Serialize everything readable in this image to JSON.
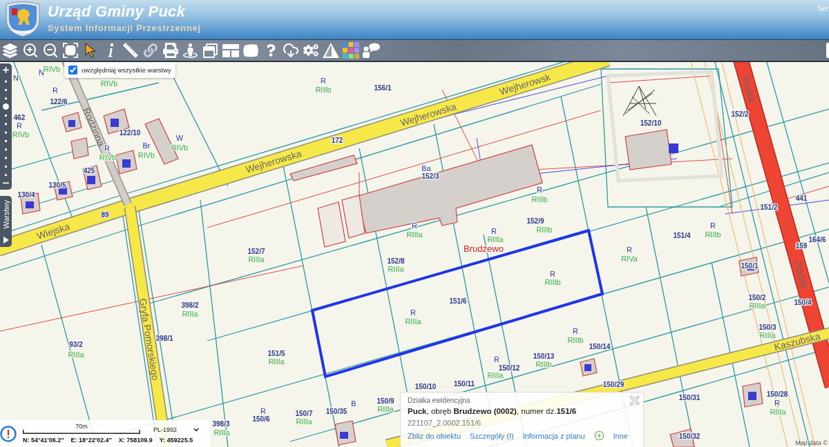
{
  "header": {
    "title": "Urząd Gminy Puck",
    "subtitle": "System Informacji Przestrzennej",
    "corner_text": "Ser"
  },
  "layer_option": {
    "label": "uwzględniaj wszystkie warstwy",
    "checked": true
  },
  "zoom_slider": {
    "level": 0.73
  },
  "layers_tab": {
    "label": "Warstwy"
  },
  "map": {
    "streets": [
      "Wejherowsk",
      "Wejherowska",
      "Pucka",
      "Rodzinna",
      "Wejherowska",
      "Wiejska",
      "Pucka",
      "Gryfa Pomorskiego",
      "Kaszubska"
    ],
    "place": "Brudzewo",
    "labels": [
      {
        "text": "N",
        "kind": "symbol"
      },
      {
        "text": "RIVb",
        "kind": "class"
      },
      {
        "text": "N",
        "kind": "symbol"
      },
      {
        "text": "RIVb",
        "kind": "class"
      },
      {
        "text": "R",
        "kind": "symbol"
      },
      {
        "text": "R",
        "kind": "symbol"
      },
      {
        "text": "RIIIb",
        "kind": "class"
      },
      {
        "text": "156/1",
        "kind": "number"
      },
      {
        "text": "122/6",
        "kind": "number"
      },
      {
        "text": "462",
        "kind": "number"
      },
      {
        "text": "152/2",
        "kind": "number"
      },
      {
        "text": "R",
        "kind": "symbol"
      },
      {
        "text": "152/10",
        "kind": "number"
      },
      {
        "text": "RIVb",
        "kind": "class"
      },
      {
        "text": "122/10",
        "kind": "number"
      },
      {
        "text": "W",
        "kind": "symbol"
      },
      {
        "text": "172",
        "kind": "number"
      },
      {
        "text": "R",
        "kind": "symbol"
      },
      {
        "text": "Br",
        "kind": "symbol"
      },
      {
        "text": "RIVb",
        "kind": "class"
      },
      {
        "text": "RIVb",
        "kind": "class"
      },
      {
        "text": "RIVb",
        "kind": "class"
      },
      {
        "text": "425",
        "kind": "number"
      },
      {
        "text": "Ba",
        "kind": "symbol"
      },
      {
        "text": "152/3",
        "kind": "number"
      },
      {
        "text": "130/5",
        "kind": "number"
      },
      {
        "text": "130/4",
        "kind": "number"
      },
      {
        "text": "R",
        "kind": "symbol"
      },
      {
        "text": "RIIIb",
        "kind": "class"
      },
      {
        "text": "441",
        "kind": "number"
      },
      {
        "text": "151/2",
        "kind": "number"
      },
      {
        "text": "89",
        "kind": "number"
      },
      {
        "text": "R",
        "kind": "symbol"
      },
      {
        "text": "152/9",
        "kind": "number"
      },
      {
        "text": "R",
        "kind": "symbol"
      },
      {
        "text": "RIIIa",
        "kind": "class"
      },
      {
        "text": "R",
        "kind": "symbol"
      },
      {
        "text": "RIIIa",
        "kind": "class"
      },
      {
        "text": "RIIIb",
        "kind": "class"
      },
      {
        "text": "151/4",
        "kind": "number"
      },
      {
        "text": "RIIIb",
        "kind": "class"
      },
      {
        "text": "159",
        "kind": "number"
      },
      {
        "text": "164/6",
        "kind": "number"
      },
      {
        "text": "152/7",
        "kind": "number"
      },
      {
        "text": "R",
        "kind": "symbol"
      },
      {
        "text": "RIIIa",
        "kind": "class"
      },
      {
        "text": "152/8",
        "kind": "number"
      },
      {
        "text": "RIVa",
        "kind": "class"
      },
      {
        "text": "RIIIa",
        "kind": "class"
      },
      {
        "text": "150/1",
        "kind": "number"
      },
      {
        "text": "R",
        "kind": "symbol"
      },
      {
        "text": "RIIIb",
        "kind": "class"
      },
      {
        "text": "398/2",
        "kind": "number"
      },
      {
        "text": "151/6",
        "kind": "number"
      },
      {
        "text": "150/2",
        "kind": "number"
      },
      {
        "text": "RIIIa",
        "kind": "class"
      },
      {
        "text": "150/4",
        "kind": "number"
      },
      {
        "text": "RIIIa",
        "kind": "class"
      },
      {
        "text": "R",
        "kind": "symbol"
      },
      {
        "text": "RIIIa",
        "kind": "class"
      },
      {
        "text": "R",
        "kind": "symbol"
      },
      {
        "text": "150/3",
        "kind": "number"
      },
      {
        "text": "398/1",
        "kind": "number"
      },
      {
        "text": "RIIIb",
        "kind": "class"
      },
      {
        "text": "RIIIa",
        "kind": "class"
      },
      {
        "text": "93/2",
        "kind": "number"
      },
      {
        "text": "150/14",
        "kind": "number"
      },
      {
        "text": "RIIIa",
        "kind": "class"
      },
      {
        "text": "151/5",
        "kind": "number"
      },
      {
        "text": "RIIIa",
        "kind": "class"
      },
      {
        "text": "R",
        "kind": "symbol"
      },
      {
        "text": "150/13",
        "kind": "number"
      },
      {
        "text": "150/12",
        "kind": "number"
      },
      {
        "text": "RIIIb",
        "kind": "class"
      },
      {
        "text": "RIIIa",
        "kind": "class"
      },
      {
        "text": "150/10",
        "kind": "number"
      },
      {
        "text": "150/11",
        "kind": "number"
      },
      {
        "text": "150/29",
        "kind": "number"
      },
      {
        "text": "150/31",
        "kind": "number"
      },
      {
        "text": "150/28",
        "kind": "number"
      },
      {
        "text": "B",
        "kind": "symbol"
      },
      {
        "text": "150/9",
        "kind": "number"
      },
      {
        "text": "R",
        "kind": "symbol"
      },
      {
        "text": "R",
        "kind": "symbol"
      },
      {
        "text": "150/7",
        "kind": "number"
      },
      {
        "text": "150/35",
        "kind": "number"
      },
      {
        "text": "RIIIa",
        "kind": "class"
      },
      {
        "text": "RIIIa",
        "kind": "class"
      },
      {
        "text": "398/3",
        "kind": "number"
      },
      {
        "text": "150/6",
        "kind": "number"
      },
      {
        "text": "RIIIa",
        "kind": "class"
      },
      {
        "text": "RIIIa",
        "kind": "class"
      },
      {
        "text": "150/32",
        "kind": "number"
      }
    ]
  },
  "scale": {
    "label": "70m"
  },
  "projection": {
    "value": "PL-1992"
  },
  "coordinates": [
    "N: 54°41′06.2″",
    "E: 18°22′02.4″",
    "X: 758109.9",
    "Y: 459225.5"
  ],
  "popup": {
    "heading": "Działka ewidencyjna",
    "description": "**Puck**, obręb **Brudzewo (0002)**, numer dz.**151/6**",
    "id": "221107_2.0002.151/6",
    "links": [
      "Zbliz do obiektu",
      "Szczegóły (I)",
      "Informacja z planu"
    ],
    "more": "Inne"
  },
  "attribution": "Map data ©"
}
